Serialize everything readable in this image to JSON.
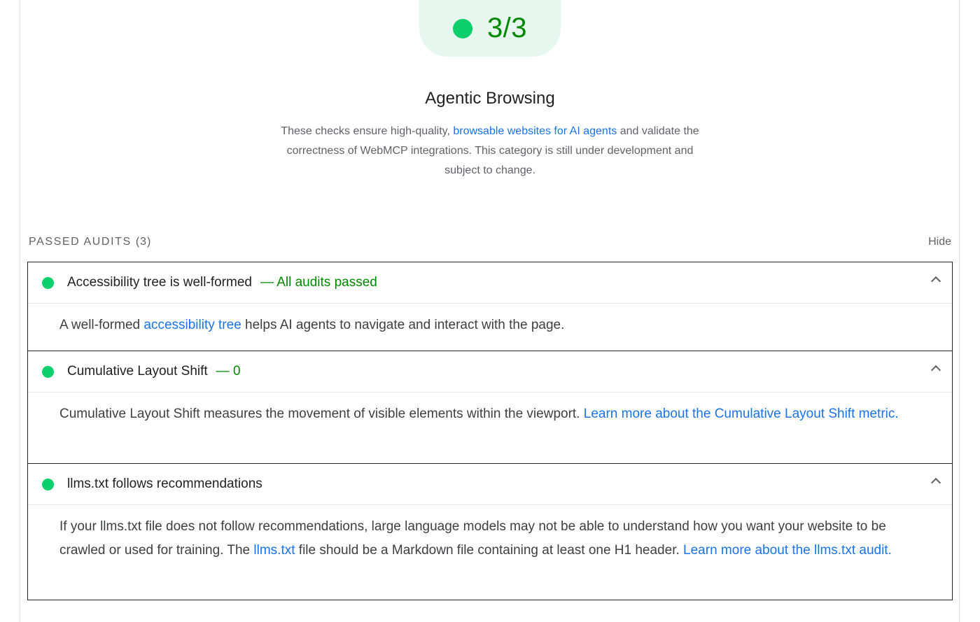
{
  "score": {
    "value": "3/3",
    "color": "#0cce6b"
  },
  "category": {
    "title": "Agentic Browsing",
    "desc_before": "These checks ensure high-quality, ",
    "desc_link": "browsable websites for AI agents",
    "desc_after": " and validate the correctness of WebMCP integrations. This category is still under development and subject to change."
  },
  "passed": {
    "label": "PASSED AUDITS",
    "count": "(3)",
    "hide_label": "Hide"
  },
  "audits": [
    {
      "title": "Accessibility tree is well-formed",
      "status": "— All audits passed",
      "body_before": "A well-formed ",
      "body_link": "accessibility tree",
      "body_after": " helps AI agents to navigate and interact with the page."
    },
    {
      "title": "Cumulative Layout Shift",
      "status": "— 0",
      "body_before": "Cumulative Layout Shift measures the movement of visible elements within the viewport. ",
      "body_link": "Learn more about the Cumulative Layout Shift metric",
      "body_after": "."
    },
    {
      "title": "llms.txt follows recommendations",
      "status": "",
      "body_before": "If your llms.txt file does not follow recommendations, large language models may not be able to understand how you want your website to be crawled or used for training. The ",
      "body_link": "llms.txt",
      "body_middle": " file should be a Markdown file containing at least one H1 header. ",
      "body_link2": "Learn more about the llms.txt audit",
      "body_after": "."
    }
  ],
  "colors": {
    "pass_green": "#0cce6b",
    "pass_text": "#008800",
    "link_blue": "#1a73e8"
  }
}
